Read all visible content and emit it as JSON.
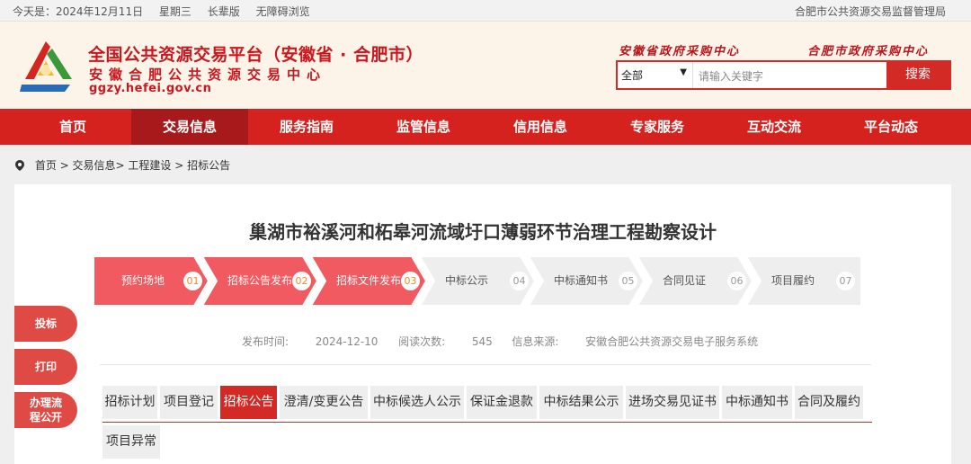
{
  "topbar": {
    "today_label": "今天是：2024年12月11日",
    "weekday": "星期三",
    "elder": "长辈版",
    "accessibility": "无障碍浏览",
    "right_link": "合肥市公共资源交易监督管理局"
  },
  "header": {
    "title": "全国公共资源交易平台（安徽省 · 合肥市）",
    "subtitle": "安徽合肥公共资源交易中心",
    "url": "ggzy.hefei.gov.cn",
    "link_province": "安徽省政府采购中心",
    "link_city": "合肥市政府采购中心"
  },
  "search": {
    "scope": "全部",
    "placeholder": "请输入关键字",
    "button": "搜索"
  },
  "nav": {
    "items": [
      {
        "label": "首页"
      },
      {
        "label": "交易信息"
      },
      {
        "label": "服务指南"
      },
      {
        "label": "监管信息"
      },
      {
        "label": "信用信息"
      },
      {
        "label": "专家服务"
      },
      {
        "label": "互动交流"
      },
      {
        "label": "平台动态"
      }
    ],
    "active": "交易信息"
  },
  "breadcrumb": "首页 > 交易信息> 工程建设 > 招标公告",
  "article": {
    "title": "巢湖市裕溪河和柘皋河流域圩口薄弱环节治理工程勘察设计",
    "publish_label": "发布时间:",
    "publish_date": "2024-12-10",
    "reads_label": "阅读次数:",
    "reads": "545",
    "source_label": "信息来源:",
    "source": "安徽合肥公共资源交易电子服务系统"
  },
  "steps": [
    {
      "label": "预约场地",
      "num": "01",
      "done": true
    },
    {
      "label": "招标公告发布",
      "num": "02",
      "done": true
    },
    {
      "label": "招标文件发布",
      "num": "03",
      "done": true
    },
    {
      "label": "中标公示",
      "num": "04",
      "done": false
    },
    {
      "label": "中标通知书",
      "num": "05",
      "done": false
    },
    {
      "label": "合同见证",
      "num": "06",
      "done": false
    },
    {
      "label": "项目履约",
      "num": "07",
      "done": false
    }
  ],
  "tabs": [
    {
      "label": "招标计划"
    },
    {
      "label": "项目登记"
    },
    {
      "label": "招标公告"
    },
    {
      "label": "澄清/变更公告"
    },
    {
      "label": "中标候选人公示"
    },
    {
      "label": "保证金退款"
    },
    {
      "label": "中标结果公示"
    },
    {
      "label": "进场交易见证书"
    },
    {
      "label": "中标通知书"
    },
    {
      "label": "合同及履约"
    },
    {
      "label": "项目异常"
    }
  ],
  "active_tab": "招标公告",
  "side_buttons": {
    "bid": "投标",
    "print": "打印",
    "process_line1": "办理流",
    "process_line2": "程公开"
  },
  "colors": {
    "brand_red": "#d6221f",
    "nav_active": "#a8191c",
    "step_done": "#f15a60",
    "step_todo": "#eeeeee",
    "header_bg": "#fdf4e9"
  }
}
